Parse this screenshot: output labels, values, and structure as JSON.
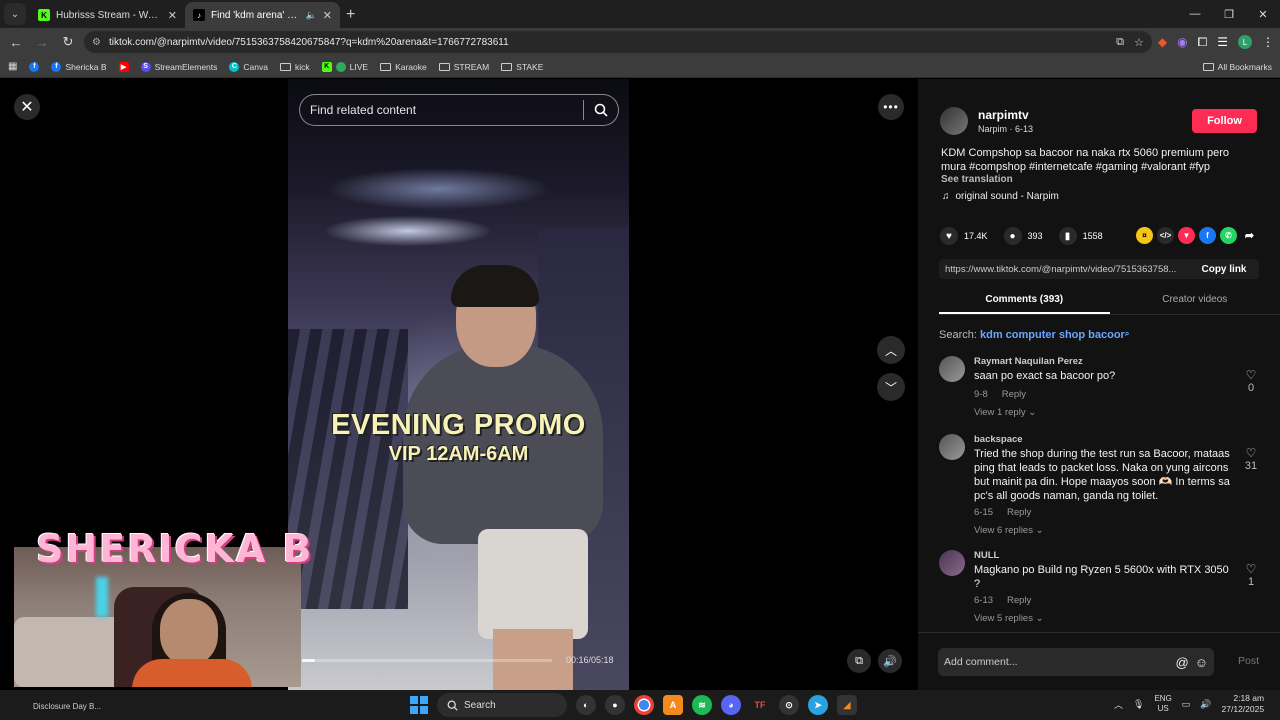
{
  "tabs": [
    {
      "title": "Hubrisss Stream - Watch Live o",
      "favicon": "K",
      "color": "#53fc18",
      "active": false
    },
    {
      "title": "Find 'kdm arena' on TikTok",
      "favicon": "tiktok-icon",
      "color": "#000000",
      "active": true
    }
  ],
  "address": {
    "url": "tiktok.com/@narpimtv/video/7515363758420675847?q=kdm%20arena&t=1766772783611"
  },
  "bookmarks": [
    {
      "label": "",
      "icon": "facebook-icon",
      "color": "#1877f2"
    },
    {
      "label": "Shericka B",
      "icon": "facebook-icon",
      "color": "#1877f2"
    },
    {
      "label": "",
      "icon": "youtube-icon",
      "color": "#ff0000"
    },
    {
      "label": "StreamElements",
      "icon": "streamelements-icon",
      "color": "#5b4de8"
    },
    {
      "label": "Canva",
      "icon": "canva-icon",
      "color": "#00c4cc"
    },
    {
      "label": "kick",
      "icon": "folder-icon",
      "color": "#cccccc"
    },
    {
      "label": "LIVE",
      "icon": "kick-icon",
      "color": "#53fc18"
    },
    {
      "label": "Karaoke",
      "icon": "folder-icon",
      "color": "#cccccc"
    },
    {
      "label": "STREAM",
      "icon": "folder-icon",
      "color": "#cccccc"
    },
    {
      "label": "STAKE",
      "icon": "folder-icon",
      "color": "#cccccc"
    }
  ],
  "all_bookmarks": "All Bookmarks",
  "video": {
    "search_placeholder": "Find related content",
    "overlay_line1": "EVENING PROMO",
    "overlay_line2": "VIP 12AM-6AM",
    "timecode": "00:16/05:18",
    "progress": 0.05
  },
  "stream_overlay": {
    "name": "SHERICKA B"
  },
  "panel": {
    "author": {
      "handle": "narpimtv",
      "subtitle": "Narpim · 6-13"
    },
    "follow_label": "Follow",
    "description": "KDM Compshop sa bacoor na naka rtx 5060 premium pero mura #compshop #internetcafe #gaming #valorant #fyp",
    "see_translation": "See translation",
    "sound": "original sound - Narpim",
    "likes": "17.4K",
    "comments_count": "393",
    "saves": "1558",
    "share_link": "https://www.tiktok.com/@narpimtv/video/7515363758...",
    "copy_link": "Copy link",
    "tab_comments": "Comments (393)",
    "tab_creator": "Creator videos",
    "search_prefix": "Search:",
    "search_query": "kdm computer shop bacoor",
    "comments": [
      {
        "name": "Raymart Naquilan Perez",
        "text": "saan po exact sa bacoor po?",
        "date": "9-8",
        "reply": "Reply",
        "replies": "View 1 reply",
        "likes": "0"
      },
      {
        "name": "backspace",
        "text": "Tried the shop during the test run sa Bacoor, mataas ping that leads to packet loss. Naka on yung aircons but mainit pa din. Hope maayos soon 🫶🏻 In terms sa pc's all goods naman, ganda ng toilet.",
        "date": "6-15",
        "reply": "Reply",
        "replies": "View 6 replies",
        "likes": "31"
      },
      {
        "name": "NULL",
        "text": "Magkano po Build ng Ryzen 5 5600x with RTX 3050 ?",
        "date": "6-13",
        "reply": "Reply",
        "replies": "View 5 replies",
        "likes": "1"
      }
    ],
    "add_comment_placeholder": "Add comment...",
    "post_label": "Post"
  },
  "taskbar": {
    "left_text": "Disclosure Day B...",
    "search_label": "Search",
    "lang_top": "ENG",
    "lang_bottom": "US",
    "time": "2:18 am",
    "date": "27/12/2025"
  }
}
